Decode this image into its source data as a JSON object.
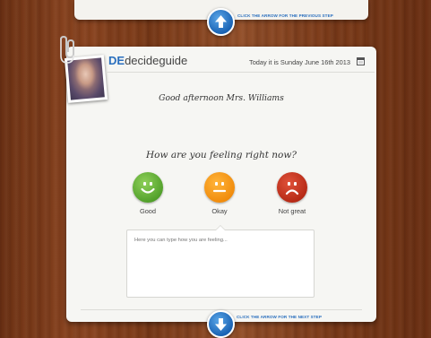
{
  "nav": {
    "previous_step_label": "CLICK THE ARROW FOR THE PREVIOUS STEP",
    "next_step_label": "CLICK THE ARROW FOR THE NEXT STEP"
  },
  "header": {
    "logo_prefix": "DE",
    "logo_text": "decideguide",
    "date_text": "Today it is Sunday June 16th 2013",
    "calendar_icon": "calendar-icon"
  },
  "main": {
    "greeting": "Good afternoon Mrs. Williams",
    "question": "How are you feeling right now?",
    "moods": [
      {
        "label": "Good",
        "icon": "happy-face-icon",
        "color": "#5aa830"
      },
      {
        "label": "Okay",
        "icon": "neutral-face-icon",
        "color": "#f59a14"
      },
      {
        "label": "Not great",
        "icon": "sad-face-icon",
        "color": "#c8341c"
      }
    ],
    "feeling_input": {
      "value": "",
      "placeholder": "Here you can type how you are feeling..."
    }
  },
  "colors": {
    "accent": "#2a6fbe",
    "card_background": "#f6f6f3"
  }
}
